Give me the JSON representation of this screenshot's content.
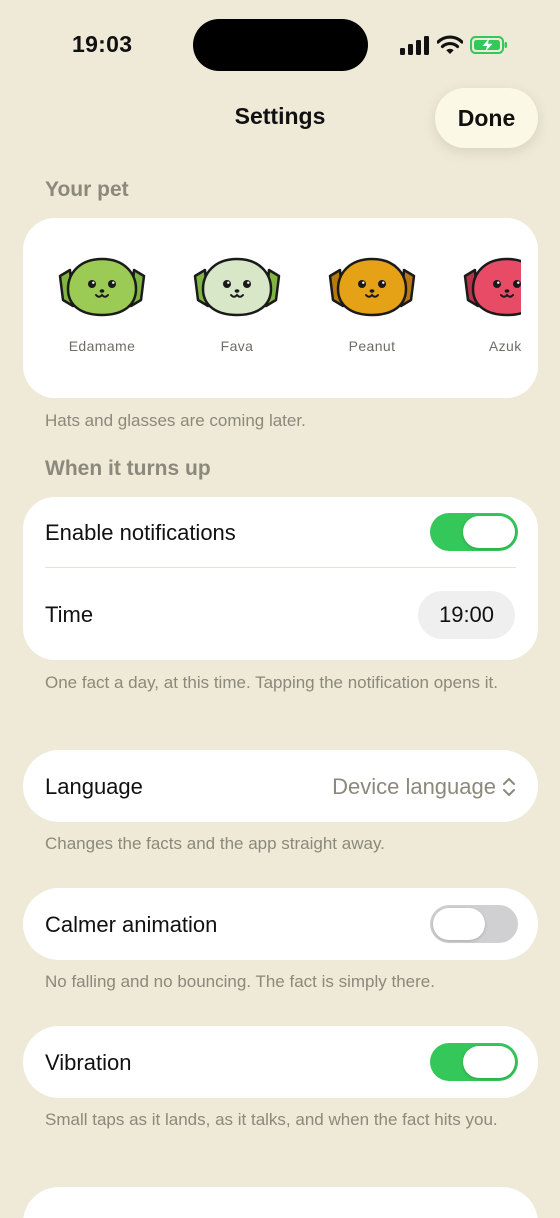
{
  "status_bar": {
    "time": "19:03"
  },
  "nav": {
    "title": "Settings",
    "done_label": "Done"
  },
  "pet_section": {
    "header": "Your pet",
    "pets": [
      {
        "name": "Edamame",
        "color": "#9CCB55"
      },
      {
        "name": "Fava",
        "color": "#D8E7C7"
      },
      {
        "name": "Peanut",
        "color": "#E6A216"
      },
      {
        "name": "Azuki",
        "color": "#E84B66"
      }
    ],
    "footer": "Hats and glasses are coming later."
  },
  "notify_section": {
    "header": "When it turns up",
    "enable_label": "Enable notifications",
    "enable_on": true,
    "time_label": "Time",
    "time_value": "19:00",
    "footer": "One fact a day, at this time. Tapping the notification opens it."
  },
  "language_section": {
    "label": "Language",
    "value": "Device language",
    "footer": "Changes the facts and the app straight away."
  },
  "calmer_section": {
    "label": "Calmer animation",
    "on": false,
    "footer": "No falling and no bouncing. The fact is simply there."
  },
  "vibration_section": {
    "label": "Vibration",
    "on": true,
    "footer": "Small taps as it lands, as it talks, and when the fact hits you."
  },
  "colors": {
    "background": "#EFEAD7",
    "toggle_on": "#34C759",
    "toggle_off": "#D0D0D2",
    "secondary_text": "#8B887C"
  }
}
